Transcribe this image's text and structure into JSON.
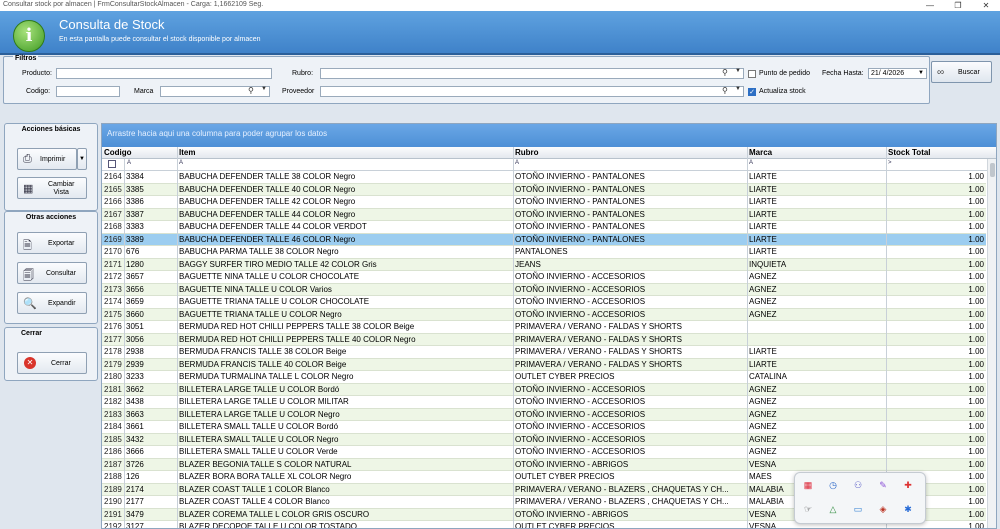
{
  "window": {
    "title": "Consultar stock por almacen | FrmConsultarStockAlmacen - Carga: 1,1662109 Seg.",
    "controls": [
      "—",
      "❐",
      "✕"
    ]
  },
  "header": {
    "title": "Consulta de Stock",
    "subtitle": "En esta pantalla puede consultar el stock disponible por almacen"
  },
  "filters": {
    "legend": "Filtros",
    "producto_label": "Producto:",
    "codigo_label": "Codigo:",
    "marca_label": "Marca",
    "rubro_label": "Rubro:",
    "proveedor_label": "Proveedor",
    "punto_pedido_label": "Punto de pedido",
    "actualiza_stock_label": "Actualiza stock",
    "fecha_label": "Fecha Hasta:",
    "fecha_value": "21/ 4/2026",
    "buscar_label": "Buscar"
  },
  "acciones_basicas": {
    "title": "Acciones básicas",
    "imprimir": "Imprimir",
    "cambiar_vista": [
      "Cambiar",
      "Vista"
    ]
  },
  "otras_acciones": {
    "title": "Otras acciones",
    "exportar": "Exportar",
    "consultar": "Consultar",
    "expandir": "Expandir"
  },
  "cerrar_panel": {
    "title": "Cerrar",
    "cerrar": "Cerrar"
  },
  "grid": {
    "group_hint": "Arrastre hacia aqui una columna para poder agrupar los datos",
    "columns": [
      "Codigo",
      "Item",
      "Rubro",
      "Marca",
      "Stock Total"
    ],
    "filter_marks": [
      "A",
      "A",
      "A",
      "A",
      ">"
    ],
    "selected_row": 5,
    "rows": [
      [
        "2164",
        "3384",
        "BABUCHA DEFENDER TALLE 38 COLOR Negro",
        "OTOÑO INVIERNO - PANTALONES",
        "LIARTE",
        "1.00"
      ],
      [
        "2165",
        "3385",
        "BABUCHA DEFENDER TALLE 40 COLOR Negro",
        "OTOÑO INVIERNO - PANTALONES",
        "LIARTE",
        "1.00"
      ],
      [
        "2166",
        "3386",
        "BABUCHA DEFENDER TALLE 42 COLOR Negro",
        "OTOÑO INVIERNO - PANTALONES",
        "LIARTE",
        "1.00"
      ],
      [
        "2167",
        "3387",
        "BABUCHA DEFENDER TALLE 44 COLOR Negro",
        "OTOÑO INVIERNO - PANTALONES",
        "LIARTE",
        "1.00"
      ],
      [
        "2168",
        "3383",
        "BABUCHA DEFENDER TALLE 44 COLOR VERDOT",
        "OTOÑO INVIERNO - PANTALONES",
        "LIARTE",
        "1.00"
      ],
      [
        "2169",
        "3389",
        "BABUCHA DEFENDER TALLE 46 COLOR Negro",
        "OTOÑO INVIERNO - PANTALONES",
        "LIARTE",
        "1.00"
      ],
      [
        "2170",
        "676",
        "BABUCHA PARMA TALLE 38 COLOR Negro",
        "PANTALONES",
        "LIARTE",
        "1.00"
      ],
      [
        "2171",
        "1280",
        "BAGGY SURFER TIRO MEDIO TALLE 42 COLOR Gris",
        "JEANS",
        "INQUIETA",
        "1.00"
      ],
      [
        "2172",
        "3657",
        "BAGUETTE NINA TALLE U COLOR CHOCOLATE",
        "OTOÑO INVIERNO - ACCESORIOS",
        "AGNEZ",
        "1.00"
      ],
      [
        "2173",
        "3656",
        "BAGUETTE NINA TALLE U COLOR Varios",
        "OTOÑO INVIERNO - ACCESORIOS",
        "AGNEZ",
        "1.00"
      ],
      [
        "2174",
        "3659",
        "BAGUETTE TRIANA TALLE U COLOR CHOCOLATE",
        "OTOÑO INVIERNO - ACCESORIOS",
        "AGNEZ",
        "1.00"
      ],
      [
        "2175",
        "3660",
        "BAGUETTE TRIANA TALLE U COLOR Negro",
        "OTOÑO INVIERNO - ACCESORIOS",
        "AGNEZ",
        "1.00"
      ],
      [
        "2176",
        "3051",
        "BERMUDA  RED HOT CHILLI PEPPERS TALLE 38 COLOR Beige",
        "PRIMAVERA / VERANO - FALDAS Y SHORTS",
        "",
        "1.00"
      ],
      [
        "2177",
        "3056",
        "BERMUDA  RED HOT CHILLI PEPPERS TALLE 40 COLOR Negro",
        "PRIMAVERA / VERANO - FALDAS Y SHORTS",
        "",
        "1.00"
      ],
      [
        "2178",
        "2938",
        "BERMUDA FRANCIS TALLE 38 COLOR Beige",
        "PRIMAVERA / VERANO - FALDAS Y SHORTS",
        "LIARTE",
        "1.00"
      ],
      [
        "2179",
        "2939",
        "BERMUDA FRANCIS TALLE 40 COLOR Beige",
        "PRIMAVERA / VERANO - FALDAS Y SHORTS",
        "LIARTE",
        "1.00"
      ],
      [
        "2180",
        "3233",
        "BERMUDA TURMALINA TALLE L COLOR Negro",
        "OUTLET CYBER PRECIOS",
        "CATALINA",
        "1.00"
      ],
      [
        "2181",
        "3662",
        "BILLETERA LARGE TALLE U COLOR Bordó",
        "OTOÑO INVIERNO - ACCESORIOS",
        "AGNEZ",
        "1.00"
      ],
      [
        "2182",
        "3438",
        "BILLETERA LARGE TALLE U COLOR MILITAR",
        "OTOÑO INVIERNO - ACCESORIOS",
        "AGNEZ",
        "1.00"
      ],
      [
        "2183",
        "3663",
        "BILLETERA LARGE TALLE U COLOR Negro",
        "OTOÑO INVIERNO - ACCESORIOS",
        "AGNEZ",
        "1.00"
      ],
      [
        "2184",
        "3661",
        "BILLETERA SMALL TALLE U COLOR Bordó",
        "OTOÑO INVIERNO - ACCESORIOS",
        "AGNEZ",
        "1.00"
      ],
      [
        "2185",
        "3432",
        "BILLETERA SMALL TALLE U COLOR Negro",
        "OTOÑO INVIERNO - ACCESORIOS",
        "AGNEZ",
        "1.00"
      ],
      [
        "2186",
        "3666",
        "BILLETERA SMALL TALLE U COLOR Verde",
        "OTOÑO INVIERNO - ACCESORIOS",
        "AGNEZ",
        "1.00"
      ],
      [
        "2187",
        "3726",
        "BLAZER BEGONIA TALLE S COLOR NATURAL",
        "OTOÑO INVIERNO - ABRIGOS",
        "VESNA",
        "1.00"
      ],
      [
        "2188",
        "126",
        "BLAZER BORA BORA TALLE XL COLOR Negro",
        "OUTLET CYBER PRECIOS",
        "MAES",
        "1.00"
      ],
      [
        "2189",
        "2174",
        "BLAZER COAST  TALLE 1 COLOR Blanco",
        "PRIMAVERA / VERANO - BLAZERS , CHAQUETAS Y CH...",
        "MALABIA",
        "1.00"
      ],
      [
        "2190",
        "2177",
        "BLAZER COAST  TALLE 4 COLOR Blanco",
        "PRIMAVERA / VERANO - BLAZERS , CHAQUETAS Y CH...",
        "MALABIA",
        "1.00"
      ],
      [
        "2191",
        "3479",
        "BLAZER COREMA TALLE L COLOR GRIS OSCURO",
        "OTOÑO INVIERNO - ABRIGOS",
        "VESNA",
        "1.00"
      ],
      [
        "2192",
        "3127",
        "BLAZER DECOPOE TALLE U COLOR TOSTADO",
        "OUTLET CYBER PRECIOS",
        "VESNA",
        "1.00"
      ]
    ]
  },
  "colors": {
    "row_odd": "#ffffff",
    "row_even": "#eef6e6",
    "selected": "#9ccdf0",
    "header_blue": "#4d8fd6"
  },
  "tray_icons": [
    "calendar-icon",
    "clock-icon",
    "teams-icon",
    "pen-icon",
    "anydesk-icon",
    "pointer-icon",
    "drive-icon",
    "chat-icon",
    "shield-icon",
    "bluetooth-icon"
  ]
}
